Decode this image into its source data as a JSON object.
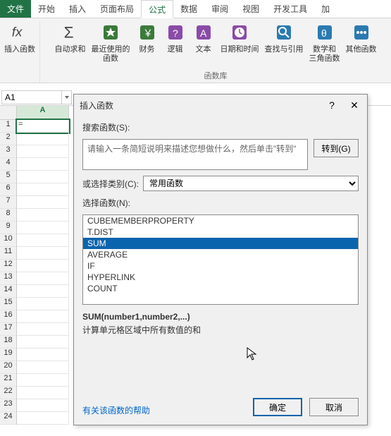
{
  "tabs": {
    "file": "文件",
    "home": "开始",
    "insert": "插入",
    "layout": "页面布局",
    "formula": "公式",
    "data": "数据",
    "review": "审阅",
    "view": "视图",
    "dev": "开发工具",
    "add": "加"
  },
  "ribbon": {
    "insertfn": "插入函数",
    "autosum": "自动求和",
    "recent": "最近使用的\n函数",
    "financial": "财务",
    "logical": "逻辑",
    "text": "文本",
    "datetime": "日期和时间",
    "lookup": "查找与引用",
    "math": "数学和\n三角函数",
    "more": "其他函数",
    "group_label": "函数库"
  },
  "namebox": "A1",
  "cell_a1": "=",
  "col_a": "A",
  "dialog": {
    "title": "插入函数",
    "search_label": "搜索函数(S):",
    "search_placeholder": "请输入一条简短说明来描述您想做什么，然后单击\"转到\"",
    "go": "转到(G)",
    "cat_label": "或选择类别(C):",
    "cat_value": "常用函数",
    "select_label": "选择函数(N):",
    "list": [
      "CUBEMEMBERPROPERTY",
      "T.DIST",
      "SUM",
      "AVERAGE",
      "IF",
      "HYPERLINK",
      "COUNT"
    ],
    "selected_index": 2,
    "sig": "SUM(number1,number2,...)",
    "desc": "计算单元格区域中所有数值的和",
    "help": "有关该函数的帮助",
    "ok": "确定",
    "cancel": "取消"
  }
}
